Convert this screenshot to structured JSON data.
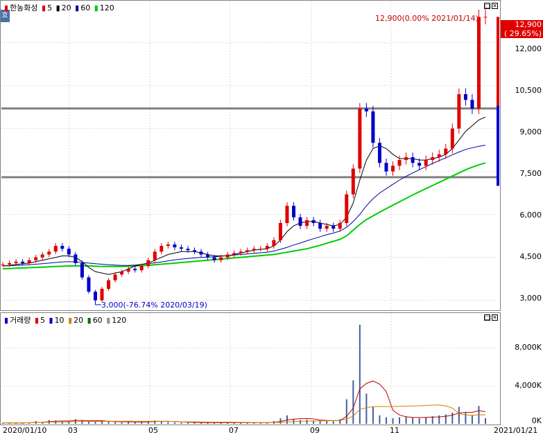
{
  "price_pane": {
    "legend": {
      "name": "한농화성",
      "ma5": "5",
      "ma20": "20",
      "ma60": "60",
      "ma120": "120"
    },
    "side_tab": "호",
    "high_annotation": "12,900(0.00% 2021/01/14)",
    "low_annotation": "3,000(-76.74% 2020/03/19)",
    "current_price": "12,900",
    "current_change": "( 29.65%)",
    "y_labels": [
      "12,000",
      "10,500",
      "9,000",
      "7,500",
      "6,000",
      "4,500",
      "3,000"
    ]
  },
  "volume_pane": {
    "legend": {
      "name": "거래량",
      "ma5": "5",
      "ma10": "10",
      "ma20": "20",
      "ma60": "60",
      "ma120": "120"
    },
    "y_labels": [
      "8,000K",
      "4,000K",
      "0K"
    ]
  },
  "x_labels": [
    "2020/01/10",
    "03",
    "05",
    "07",
    "09",
    "11",
    "2021/01/21"
  ],
  "colors": {
    "up": "#e00000",
    "down": "#0000c8",
    "ma5": "#e00000",
    "ma20": "#000000",
    "ma60": "#0000a0",
    "ma120": "#00cc00",
    "hline": "#808080"
  },
  "chart_data": {
    "type": "candlestick",
    "title": "한농화성",
    "date_range": [
      "2020/01/10",
      "2021/01/21"
    ],
    "ylim": [
      2700,
      13200
    ],
    "horizontal_lines": [
      9700,
      7300
    ],
    "high": {
      "value": 12900,
      "date": "2021/01/14"
    },
    "low": {
      "value": 3000,
      "date": "2020/03/19"
    },
    "closes": [
      4250,
      4300,
      4350,
      4300,
      4400,
      4500,
      4600,
      4700,
      4900,
      4800,
      4600,
      4300,
      3800,
      3300,
      3000,
      3400,
      3700,
      3900,
      4000,
      4100,
      4050,
      4200,
      4400,
      4700,
      4900,
      4950,
      4850,
      4800,
      4750,
      4700,
      4600,
      4500,
      4400,
      4500,
      4600,
      4650,
      4700,
      4750,
      4800,
      4800,
      4900,
      5100,
      5700,
      6300,
      5900,
      5600,
      5800,
      5700,
      5500,
      5600,
      5500,
      5700,
      6700,
      7600,
      9700,
      9600,
      8500,
      7800,
      7500,
      7700,
      7900,
      8000,
      7800,
      7700,
      7900,
      8000,
      8100,
      8300,
      9000,
      10200,
      10000,
      9700,
      12900,
      12900
    ],
    "ma20": [
      4200,
      4220,
      4250,
      4280,
      4300,
      4350,
      4400,
      4450,
      4500,
      4550,
      4550,
      4500,
      4350,
      4150,
      4000,
      3950,
      3900,
      3950,
      4000,
      4100,
      4200,
      4250,
      4300,
      4400,
      4500,
      4600,
      4650,
      4700,
      4700,
      4700,
      4650,
      4600,
      4550,
      4550,
      4550,
      4600,
      4650,
      4700,
      4750,
      4780,
      4800,
      4900,
      5100,
      5400,
      5600,
      5700,
      5750,
      5750,
      5700,
      5650,
      5600,
      5650,
      5900,
      6400,
      7200,
      7900,
      8300,
      8400,
      8300,
      8100,
      7950,
      7950,
      7950,
      7900,
      7900,
      7950,
      8000,
      8100,
      8300,
      8600,
      8900,
      9100,
      9300,
      9400
    ],
    "ma60": [
      4200,
      4210,
      4220,
      4230,
      4240,
      4260,
      4280,
      4300,
      4320,
      4340,
      4350,
      4340,
      4320,
      4300,
      4280,
      4260,
      4240,
      4230,
      4220,
      4220,
      4230,
      4250,
      4280,
      4310,
      4340,
      4380,
      4410,
      4440,
      4460,
      4480,
      4500,
      4510,
      4520,
      4540,
      4560,
      4580,
      4600,
      4620,
      4640,
      4660,
      4680,
      4720,
      4780,
      4850,
      4930,
      5000,
      5080,
      5150,
      5220,
      5290,
      5350,
      5420,
      5550,
      5750,
      6000,
      6300,
      6550,
      6750,
      6900,
      7050,
      7200,
      7330,
      7450,
      7560,
      7670,
      7780,
      7880,
      7980,
      8080,
      8180,
      8270,
      8330,
      8380,
      8420
    ],
    "ma120": [
      4100,
      4110,
      4120,
      4130,
      4140,
      4150,
      4160,
      4170,
      4180,
      4190,
      4200,
      4200,
      4200,
      4200,
      4190,
      4180,
      4180,
      4180,
      4180,
      4190,
      4200,
      4210,
      4220,
      4240,
      4260,
      4280,
      4300,
      4320,
      4340,
      4360,
      4380,
      4400,
      4420,
      4440,
      4460,
      4480,
      4500,
      4520,
      4540,
      4560,
      4580,
      4600,
      4640,
      4680,
      4720,
      4760,
      4800,
      4860,
      4920,
      4990,
      5060,
      5130,
      5250,
      5450,
      5650,
      5820,
      5950,
      6080,
      6200,
      6320,
      6440,
      6560,
      6680,
      6790,
      6900,
      7010,
      7120,
      7230,
      7340,
      7450,
      7560,
      7650,
      7730,
      7800
    ],
    "volume_k": [
      100,
      80,
      120,
      90,
      150,
      300,
      200,
      400,
      350,
      250,
      300,
      500,
      400,
      250,
      200,
      300,
      250,
      200,
      150,
      200,
      180,
      220,
      300,
      350,
      250,
      200,
      150,
      150,
      130,
      120,
      110,
      120,
      130,
      150,
      140,
      130,
      120,
      110,
      100,
      110,
      150,
      300,
      600,
      900,
      500,
      400,
      450,
      350,
      300,
      300,
      280,
      500,
      2600,
      4600,
      10500,
      3200,
      1800,
      900,
      700,
      600,
      700,
      800,
      650,
      600,
      700,
      800,
      900,
      1000,
      1200,
      1800,
      1200,
      900,
      1900,
      600
    ]
  }
}
